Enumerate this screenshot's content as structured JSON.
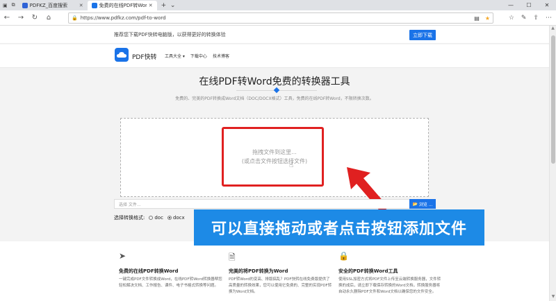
{
  "browser": {
    "tabs": [
      {
        "title": "PDFKZ_百度搜索",
        "color": "#2f63d6"
      },
      {
        "title": "免费的在线PDF转Word",
        "color": "#1a73e8"
      }
    ],
    "url": "https://www.pdfkz.com/pdf-to-word"
  },
  "promo": {
    "text": "推荐您下载PDF快转电脑版，以获得更好的转换体验",
    "button": "立即下载"
  },
  "header": {
    "brand": "PDF快转",
    "menu": [
      "工具大全 ▾",
      "下载中心",
      "技术博客"
    ]
  },
  "hero": {
    "title": "在线PDF转Word免费的转换器工具",
    "subtitle": "免费的、完美的PDF转换成Word文档（DOC/DOCX格式）工具，免费的在线PDF转Word，不限转换次数。"
  },
  "dropzone": {
    "line1": "拖拽文件到这里...",
    "line2": "(或点击文件按钮选择文件)"
  },
  "filebar": {
    "placeholder": "选择 文件...",
    "browse": "浏览 ..."
  },
  "format": {
    "label": "选择转换格式:",
    "options": [
      {
        "label": "doc",
        "checked": false
      },
      {
        "label": "docx",
        "checked": true
      }
    ]
  },
  "overlay": {
    "text": "可以直接拖动或者点击按钮添加文件"
  },
  "features": [
    {
      "title": "免费的在线PDF转换Word",
      "desc": "一键完成PDF文件转换成Word，在线PDF转Word转换器帮您轻松解决文档、工作报告、课件、电子书格式转换等问题。",
      "icon": "paper-plane-icon"
    },
    {
      "title": "完美的将PDF转换为Word",
      "desc": "PDF转Word的变高、排版搞乱？PDF快转在线免费版提供了高质量的转换效果，您可以使用它免费的、完整的实现PDF转换为Word文档。",
      "icon": "pdf-file-icon"
    },
    {
      "title": "安全的PDF转换Word工具",
      "desc": "使用SSL加密方式将PDF文件上传至云端转换服务器，文件转换的成后，请立即下载保存转换的Word文档，转换服务器将自动永久删除PDF文件和Word文档以确保您的文件安全。",
      "icon": "lock-icon"
    }
  ],
  "colors": {
    "accent": "#1a73e8",
    "highlight": "#e02020",
    "banner": "#1d8ae6"
  }
}
